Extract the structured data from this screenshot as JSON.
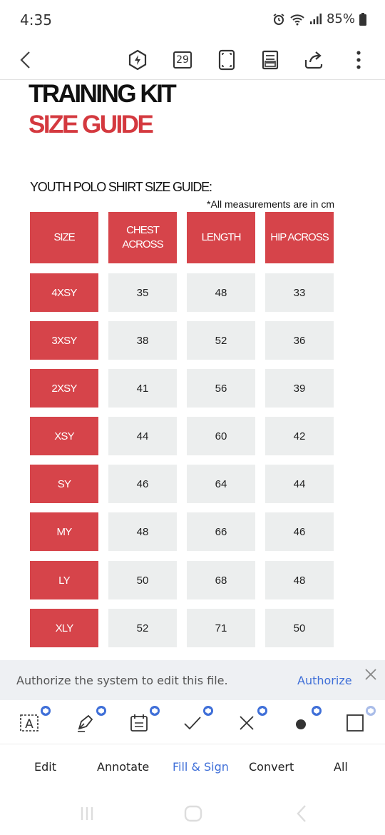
{
  "status_bar": {
    "time": "4:35",
    "battery": "85%"
  },
  "toolbar": {
    "page_count": "29"
  },
  "document": {
    "title_line1": "TRAINING KIT",
    "title_line2": "SIZE GUIDE",
    "subtitle": "YOUTH  POLO SHIRT SIZE GUIDE:",
    "note": "*All measurements are in cm",
    "table": {
      "headers": [
        "SIZE",
        "CHEST ACROSS",
        "LENGTH",
        "HIP ACROSS"
      ],
      "rows": [
        {
          "size": "4XSY",
          "chest": "35",
          "length": "48",
          "hip": "33"
        },
        {
          "size": "3XSY",
          "chest": "38",
          "length": "52",
          "hip": "36"
        },
        {
          "size": "2XSY",
          "chest": "41",
          "length": "56",
          "hip": "39"
        },
        {
          "size": "XSY",
          "chest": "44",
          "length": "60",
          "hip": "42"
        },
        {
          "size": "SY",
          "chest": "46",
          "length": "64",
          "hip": "44"
        },
        {
          "size": "MY",
          "chest": "48",
          "length": "66",
          "hip": "46"
        },
        {
          "size": "LY",
          "chest": "50",
          "length": "68",
          "hip": "48"
        },
        {
          "size": "XLY",
          "chest": "52",
          "length": "71",
          "hip": "50"
        }
      ]
    }
  },
  "banner": {
    "text": "Authorize the system to edit this file.",
    "action": "Authorize"
  },
  "tabs": [
    {
      "label": "Edit",
      "active": false
    },
    {
      "label": "Annotate",
      "active": false
    },
    {
      "label": "Fill & Sign",
      "active": true
    },
    {
      "label": "Convert",
      "active": false
    },
    {
      "label": "All",
      "active": false
    }
  ],
  "colors": {
    "accent": "#d6444a",
    "link": "#3f6fd8",
    "cell": "#eceeee"
  }
}
